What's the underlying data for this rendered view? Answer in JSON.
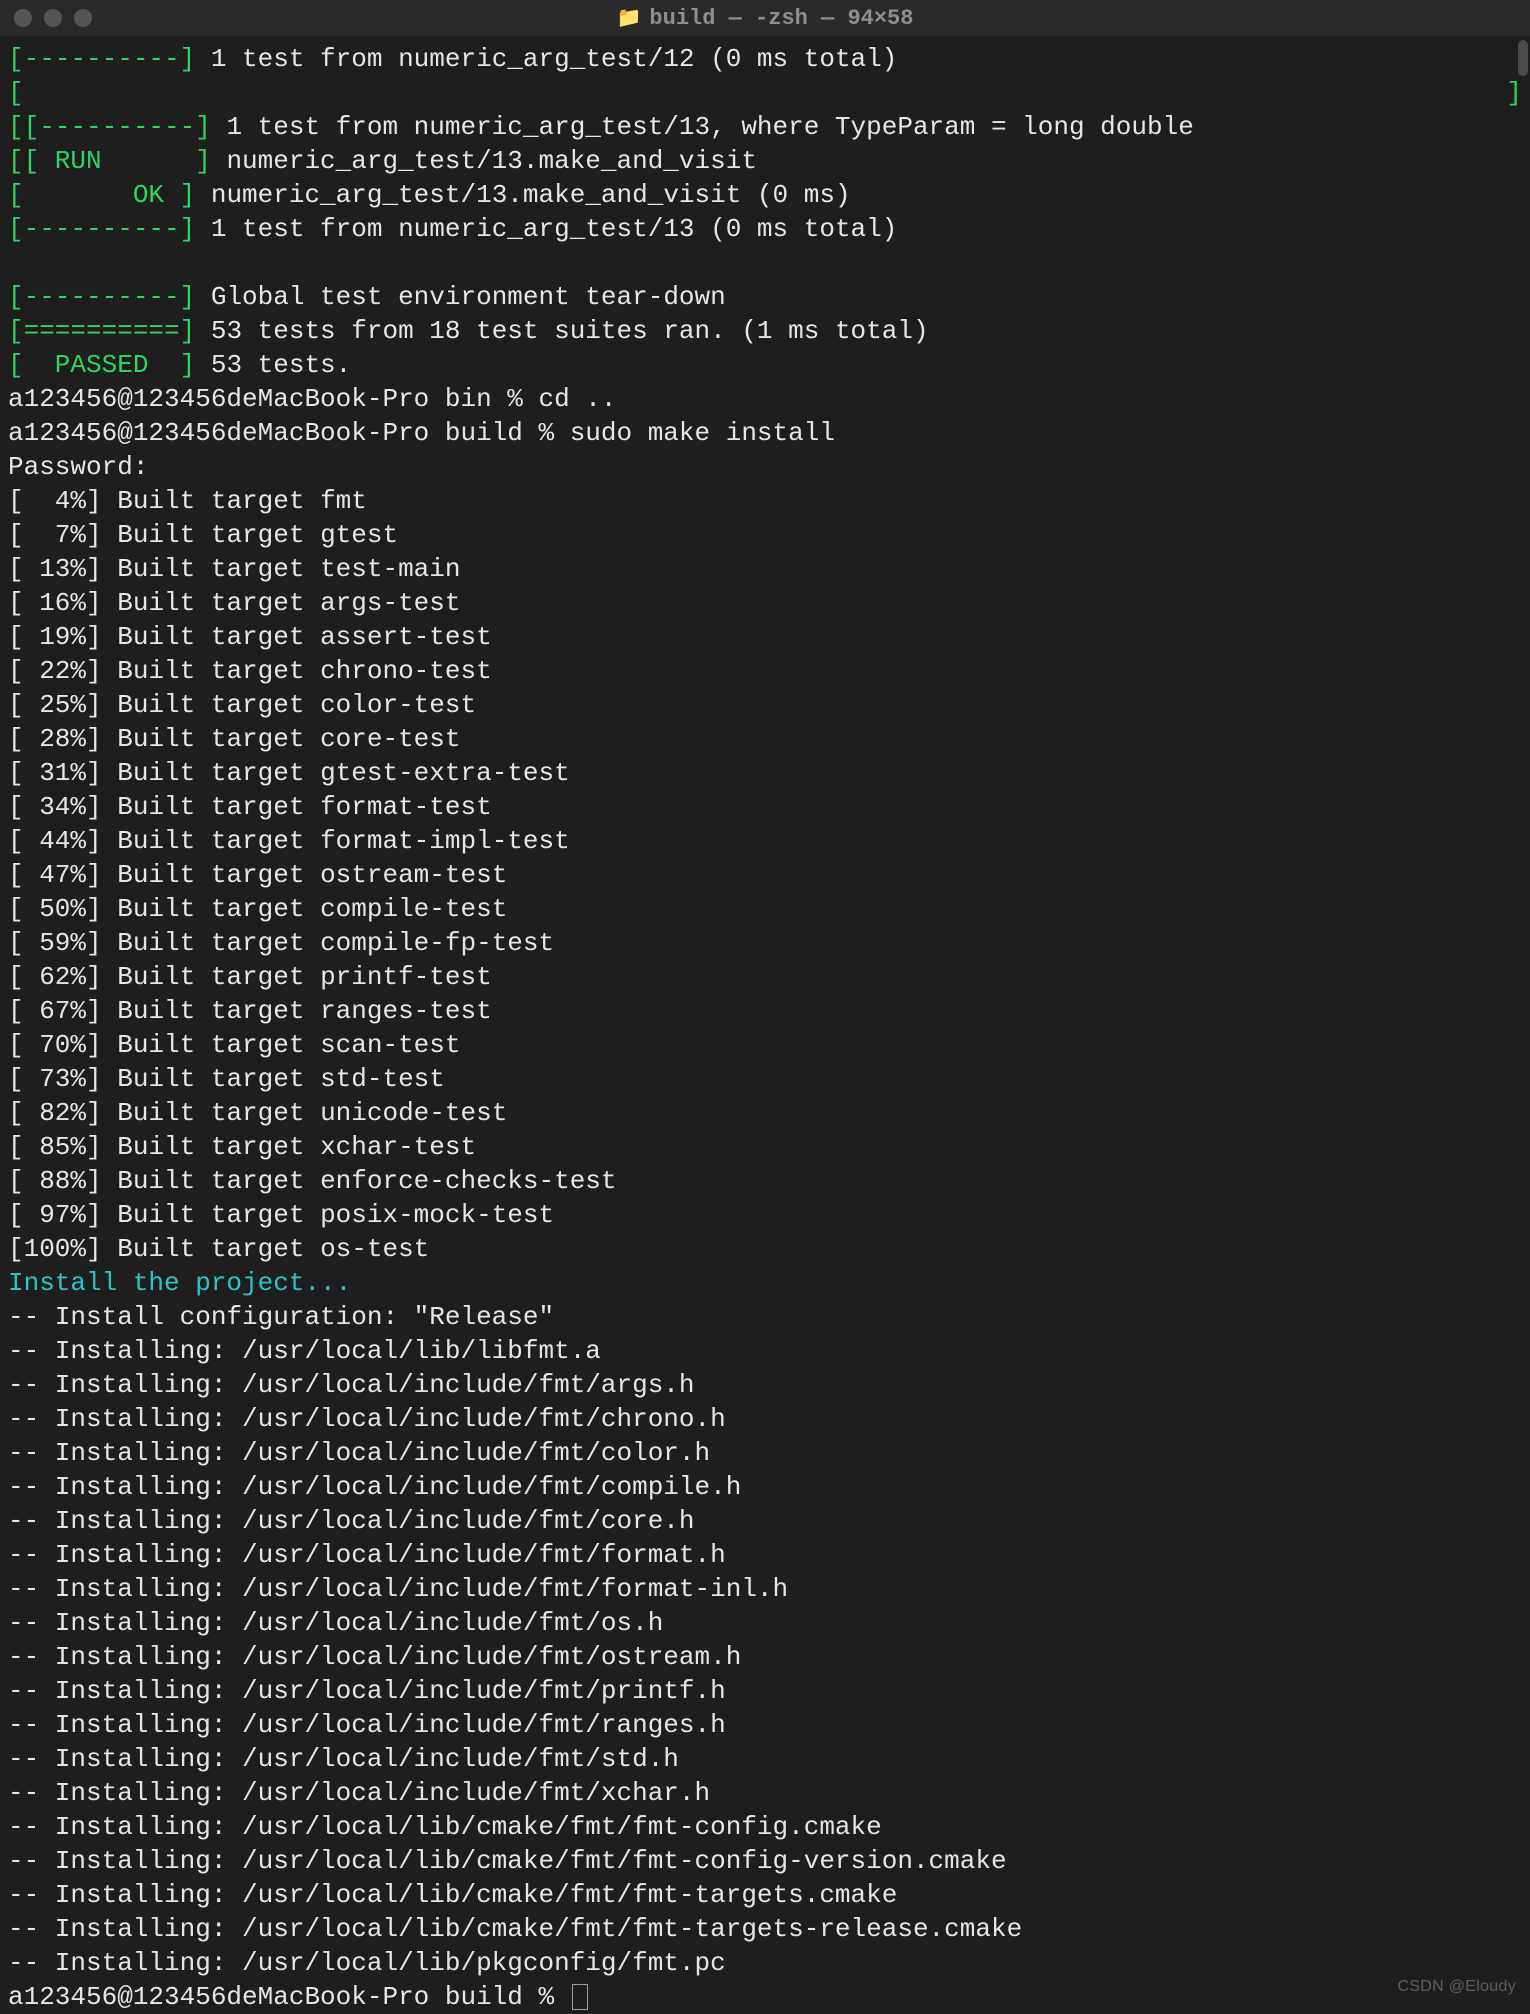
{
  "window": {
    "title": "build — -zsh — 94×58",
    "folder_glyph": "📁"
  },
  "tests": {
    "end12": "1 test from numeric_arg_test/12 (0 ms total)",
    "start13a": "1 test from numeric_arg_test/13, where TypeParam = long double",
    "run13": "numeric_arg_test/13.make_and_visit",
    "ok13": "numeric_arg_test/13.make_and_visit (0 ms)",
    "end13": "1 test from numeric_arg_test/13 (0 ms total)",
    "teardown": "Global test environment tear-down",
    "summary": "53 tests from 18 test suites ran. (1 ms total)",
    "passed": "53 tests.",
    "tag_dash": "[----------] ",
    "tag_dash2": "[[----------] ",
    "tag_run": "[[ RUN      ] ",
    "tag_ok": "[       OK ] ",
    "tag_eq": "[==========] ",
    "tag_passed": "[  PASSED  ] ",
    "open_only": "[",
    "close_only": "]"
  },
  "shell": {
    "prompt1": "a123456@123456deMacBook-Pro bin % cd ..",
    "prompt2": "a123456@123456deMacBook-Pro build % sudo make install",
    "password": "Password:",
    "last_prompt": "a123456@123456deMacBook-Pro build % "
  },
  "build": {
    "targets": [
      {
        "pct": "[  4%]",
        "text": "Built target fmt"
      },
      {
        "pct": "[  7%]",
        "text": "Built target gtest"
      },
      {
        "pct": "[ 13%]",
        "text": "Built target test-main"
      },
      {
        "pct": "[ 16%]",
        "text": "Built target args-test"
      },
      {
        "pct": "[ 19%]",
        "text": "Built target assert-test"
      },
      {
        "pct": "[ 22%]",
        "text": "Built target chrono-test"
      },
      {
        "pct": "[ 25%]",
        "text": "Built target color-test"
      },
      {
        "pct": "[ 28%]",
        "text": "Built target core-test"
      },
      {
        "pct": "[ 31%]",
        "text": "Built target gtest-extra-test"
      },
      {
        "pct": "[ 34%]",
        "text": "Built target format-test"
      },
      {
        "pct": "[ 44%]",
        "text": "Built target format-impl-test"
      },
      {
        "pct": "[ 47%]",
        "text": "Built target ostream-test"
      },
      {
        "pct": "[ 50%]",
        "text": "Built target compile-test"
      },
      {
        "pct": "[ 59%]",
        "text": "Built target compile-fp-test"
      },
      {
        "pct": "[ 62%]",
        "text": "Built target printf-test"
      },
      {
        "pct": "[ 67%]",
        "text": "Built target ranges-test"
      },
      {
        "pct": "[ 70%]",
        "text": "Built target scan-test"
      },
      {
        "pct": "[ 73%]",
        "text": "Built target std-test"
      },
      {
        "pct": "[ 82%]",
        "text": "Built target unicode-test"
      },
      {
        "pct": "[ 85%]",
        "text": "Built target xchar-test"
      },
      {
        "pct": "[ 88%]",
        "text": "Built target enforce-checks-test"
      },
      {
        "pct": "[ 97%]",
        "text": "Built target posix-mock-test"
      },
      {
        "pct": "[100%]",
        "text": "Built target os-test"
      }
    ]
  },
  "install": {
    "header": "Install the project...",
    "config": "-- Install configuration: \"Release\"",
    "files": [
      "-- Installing: /usr/local/lib/libfmt.a",
      "-- Installing: /usr/local/include/fmt/args.h",
      "-- Installing: /usr/local/include/fmt/chrono.h",
      "-- Installing: /usr/local/include/fmt/color.h",
      "-- Installing: /usr/local/include/fmt/compile.h",
      "-- Installing: /usr/local/include/fmt/core.h",
      "-- Installing: /usr/local/include/fmt/format.h",
      "-- Installing: /usr/local/include/fmt/format-inl.h",
      "-- Installing: /usr/local/include/fmt/os.h",
      "-- Installing: /usr/local/include/fmt/ostream.h",
      "-- Installing: /usr/local/include/fmt/printf.h",
      "-- Installing: /usr/local/include/fmt/ranges.h",
      "-- Installing: /usr/local/include/fmt/std.h",
      "-- Installing: /usr/local/include/fmt/xchar.h",
      "-- Installing: /usr/local/lib/cmake/fmt/fmt-config.cmake",
      "-- Installing: /usr/local/lib/cmake/fmt/fmt-config-version.cmake",
      "-- Installing: /usr/local/lib/cmake/fmt/fmt-targets.cmake",
      "-- Installing: /usr/local/lib/cmake/fmt/fmt-targets-release.cmake",
      "-- Installing: /usr/local/lib/pkgconfig/fmt.pc"
    ]
  },
  "watermark": "CSDN @Eloudy"
}
